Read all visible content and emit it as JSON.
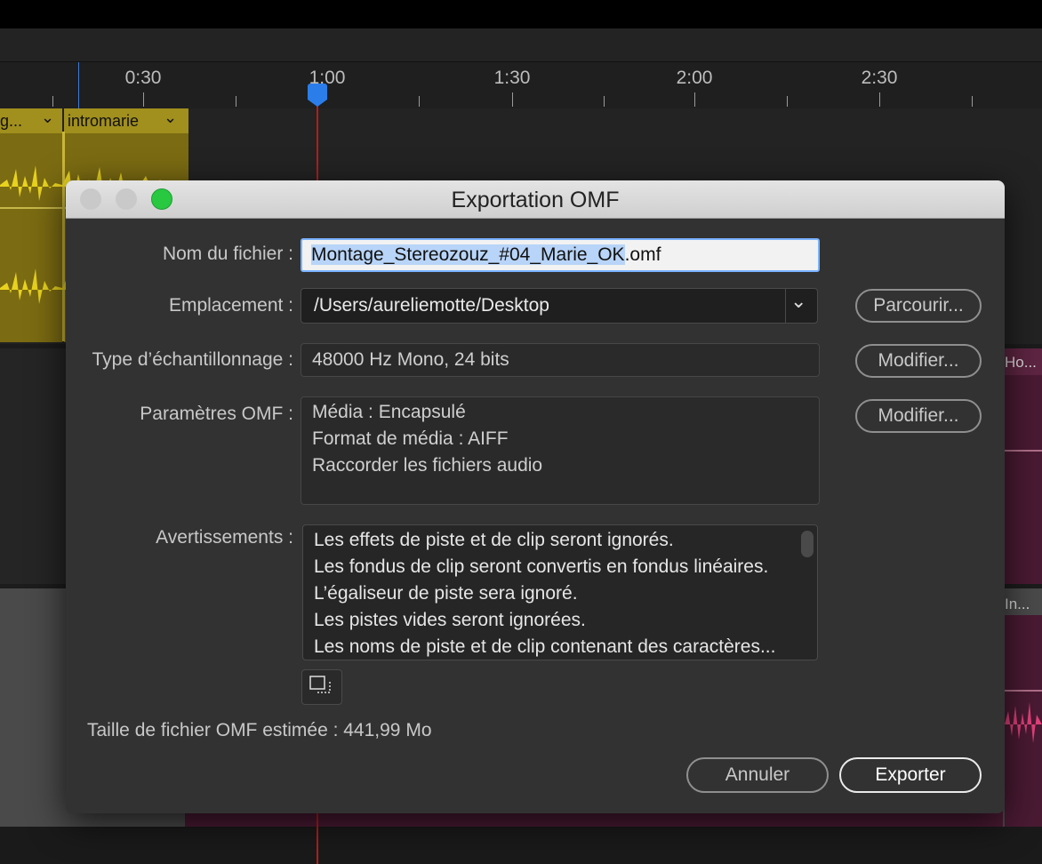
{
  "timeline": {
    "ruler_labels": [
      "0:30",
      "1:00",
      "1:30",
      "2:00",
      "2:30"
    ],
    "clips": {
      "left_clip_label": "g...",
      "intromarie_label": "intromarie",
      "right_top_label": "Ho...",
      "right_bottom_label": "In..."
    }
  },
  "dialog": {
    "title": "Exportation OMF",
    "filename_label": "Nom du fichier :",
    "filename_selected": "Montage_Stereozouz_#04_Marie_OK",
    "filename_ext": ".omf",
    "location_label": "Emplacement :",
    "location_value": "/Users/aureliemotte/Desktop",
    "browse_button": "Parcourir...",
    "sampling_label": "Type d’échantillonnage :",
    "sampling_value": "48000 Hz Mono, 24 bits",
    "modify_button_1": "Modifier...",
    "omf_params_label": "Paramètres OMF :",
    "omf_params": [
      "Média : Encapsulé",
      "Format de média : AIFF",
      "Raccorder les fichiers audio"
    ],
    "modify_button_2": "Modifier...",
    "warnings_label": "Avertissements :",
    "warnings": [
      "Les effets de piste et de clip seront ignorés.",
      "Les fondus de clip seront convertis en fondus linéaires.",
      "L’égaliseur de piste sera ignoré.",
      "Les pistes vides seront ignorées.",
      "Les noms de piste et de clip contenant des caractères..."
    ],
    "estimated_size": "Taille de fichier OMF estimée : 441,99 Mo",
    "cancel_button": "Annuler",
    "export_button": "Exporter"
  },
  "colors": {
    "accent": "#2b7de9",
    "playhead": "#b71c1c",
    "clip_yellow": "#a18f1e",
    "clip_pink": "#5e2542",
    "traffic_red": "#c9c9c9",
    "traffic_green": "#28c840"
  }
}
